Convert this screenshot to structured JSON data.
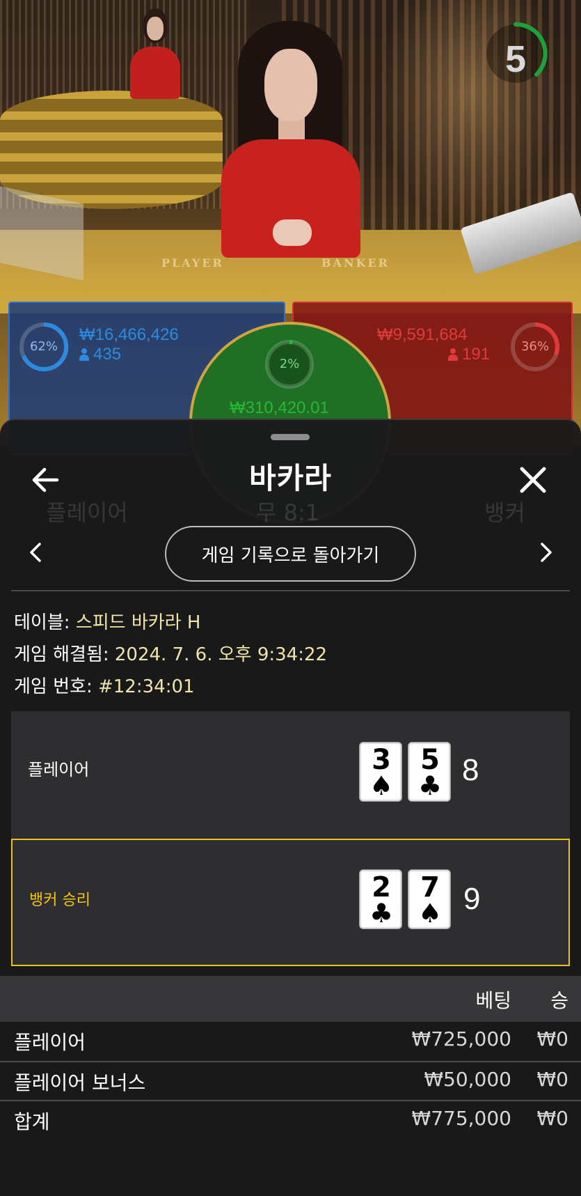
{
  "video": {
    "timer_value": "5",
    "felt_player": "PLAYER",
    "felt_banker": "BANKER"
  },
  "bet_spots": {
    "player": {
      "percent": "62%",
      "amount": "₩16,466,426",
      "players": "435",
      "color": "#2b8be0"
    },
    "banker": {
      "percent": "36%",
      "amount": "₩9,591,684",
      "players": "191",
      "color": "#e03b3b"
    },
    "tie": {
      "percent": "2%",
      "amount": "₩310,420.01",
      "color": "#27b835"
    }
  },
  "sheet": {
    "title": "바카라",
    "return_button": "게임 기록으로 돌아가기",
    "info": {
      "table_label": "테이블:",
      "table_value": "스피드 바카라 H",
      "resolved_label": "게임 해결됨:",
      "resolved_value": "2024. 7. 6. 오후 9:34:22",
      "number_label": "게임 번호:",
      "number_value": "#12:34:01"
    },
    "results": {
      "player": {
        "label": "플레이어",
        "cards": [
          {
            "rank": "3",
            "suit": "♠"
          },
          {
            "rank": "5",
            "suit": "♣"
          }
        ],
        "score": "8"
      },
      "banker": {
        "label": "뱅커 승리",
        "cards": [
          {
            "rank": "2",
            "suit": "♣"
          },
          {
            "rank": "7",
            "suit": "♠"
          }
        ],
        "score": "9",
        "highlight_color": "#e9c21a"
      }
    },
    "bets": {
      "col_bet": "베팅",
      "col_win": "승",
      "rows": [
        {
          "label": "플레이어",
          "bet": "₩725,000",
          "win": "₩0"
        },
        {
          "label": "플레이어 보너스",
          "bet": "₩50,000",
          "win": "₩0"
        },
        {
          "label": "합계",
          "bet": "₩775,000",
          "win": "₩0"
        }
      ]
    }
  }
}
